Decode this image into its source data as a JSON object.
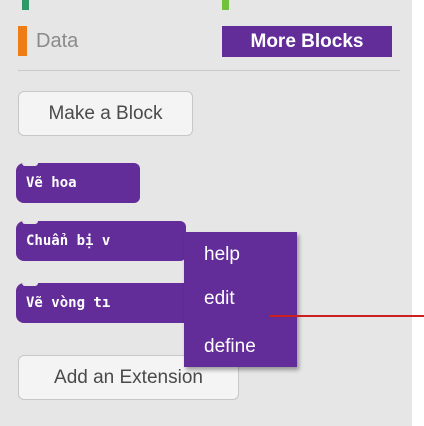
{
  "categories": {
    "data_label": "Data",
    "more_blocks_label": "More Blocks",
    "data_color": "#ee7d16",
    "more_blocks_color": "#632d99"
  },
  "buttons": {
    "make_block": "Make a Block",
    "add_extension": "Add an Extension"
  },
  "blocks": [
    {
      "label": "Vẽ hoa"
    },
    {
      "label": "Chuẩn bị v"
    },
    {
      "label": "Vẽ vòng tı"
    }
  ],
  "context_menu": {
    "items": [
      "help",
      "edit",
      "define"
    ]
  },
  "colors": {
    "panel_bg": "#e6e6e6",
    "block_purple": "#632d99",
    "annotation_line": "#cc1f1f"
  }
}
